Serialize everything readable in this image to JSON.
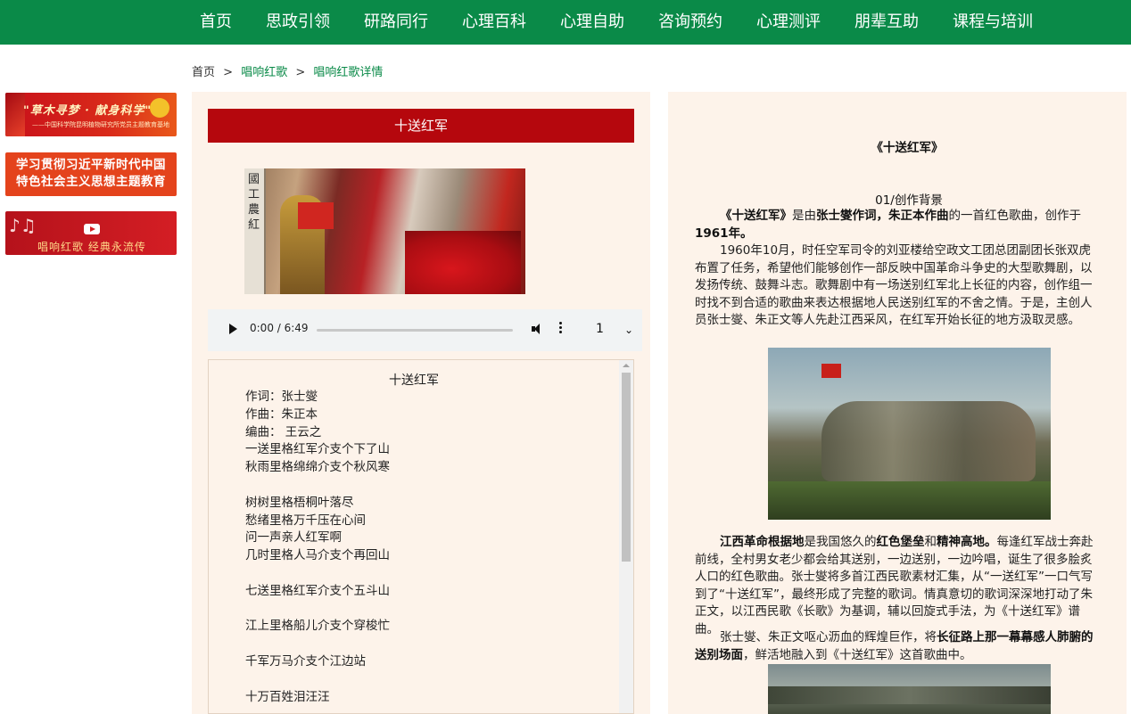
{
  "nav": {
    "items": [
      "首页",
      "思政引领",
      "研路同行",
      "心理百科",
      "心理自助",
      "咨询预约",
      "心理测评",
      "朋辈互助",
      "课程与培训"
    ]
  },
  "breadcrumb": {
    "home": "首页",
    "sep1": ">",
    "level1": "唱响红歌",
    "sep2": ">",
    "level2": "唱响红歌详情"
  },
  "banners": {
    "b1_title": "\"草木寻梦 · 献身科学\"",
    "b1_sub": "——中国科学院昆明植物研究所党员主题教育基地",
    "b2_line1": "学习贯彻习近平新时代中国",
    "b2_line2": "特色社会主义思想主题教育",
    "b3_text": "唱响红歌  经典永流传"
  },
  "song": {
    "title": "十送红军",
    "cover_sign": "國工農紅"
  },
  "player": {
    "time": "0:00 / 6:49",
    "speed": "1",
    "progress": 0
  },
  "lyrics": {
    "title": "十送红军",
    "lines": [
      "作词：张士燮",
      "作曲：朱正本",
      "编曲： 王云之",
      "一送里格红军介支个下了山",
      "秋雨里格绵绵介支个秋风寒",
      "",
      "树树里格梧桐叶落尽",
      "愁绪里格万千压在心间",
      "问一声亲人红军啊",
      "几时里格人马介支个再回山",
      "",
      "七送里格红军介支个五斗山",
      "",
      "江上里格船儿介支个穿梭忙",
      "",
      "千军万马介支个江边站",
      "",
      "十万百姓泪汪汪"
    ]
  },
  "article": {
    "title": "《十送红军》",
    "section": "01/创作背景",
    "p1_a": "《十送红军》",
    "p1_b": "是由",
    "p1_c": "张士燮作词，朱正本作曲",
    "p1_d": "的一首红色歌曲，创作于",
    "p1_e": "1961年。",
    "p2": "1960年10月，时任空军司令的刘亚楼给空政文工团总团副团长张双虎布置了任务，希望他们能够创作一部反映中国革命斗争史的大型歌舞剧，以发扬传统、鼓舞斗志。歌舞剧中有一场送别红军北上长征的内容，创作组一时找不到合适的歌曲来表达根据地人民送别红军的不舍之情。于是，主创人员张士燮、朱正文等人先赴江西采风，在红军开始长征的地方汲取灵感。",
    "p3_a": "江西革命根据地",
    "p3_b": "是我国悠久的",
    "p3_c": "红色堡垒",
    "p3_d": "和",
    "p3_e": "精神高地。",
    "p3_f": "每逢红军战士奔赴前线，全村男女老少都会给其送别，一边送别，一边吟唱，诞生了很多脍炙人口的红色歌曲。张士燮将多首江西民歌素材汇集，从“一送红军”一口气写到了“十送红军”，最终形成了完整的歌词。情真意切的歌词深深地打动了朱正文，以江西民歌《长歌》为基调，辅以回旋式手法，为《十送红军》谱曲。",
    "p4_a": "张士燮、朱正文呕心沥血的辉煌巨作，将",
    "p4_b": "长征路上那一幕幕感人肺腑的送别场面",
    "p4_c": "，鲜活地融入到《十送红军》这首歌曲中。"
  }
}
